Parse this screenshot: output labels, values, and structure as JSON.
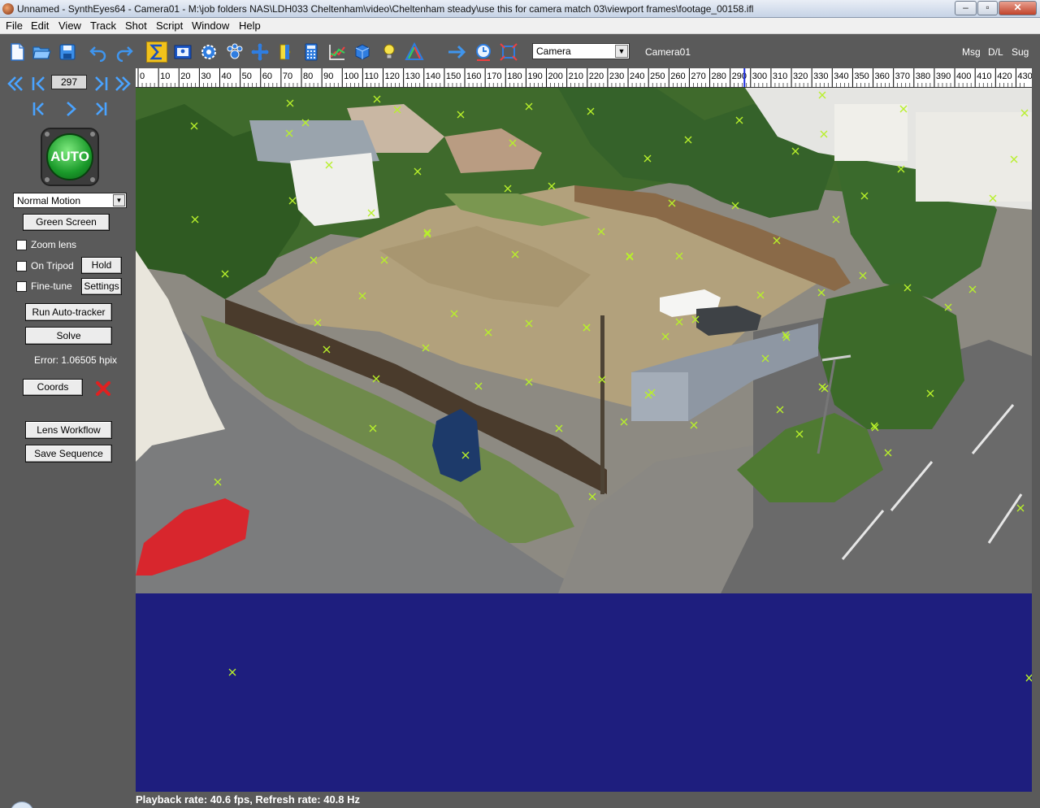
{
  "window": {
    "title": "Unnamed - SynthEyes64 - Camera01 - M:\\job folders NAS\\LDH033 Cheltenham\\video\\Cheltenham steady\\use this for camera match 03\\viewport frames\\footage_00158.ifl",
    "minimize_label": "–",
    "maximize_label": "▫",
    "close_label": "✕"
  },
  "menu": {
    "items": [
      {
        "label": "File"
      },
      {
        "label": "Edit"
      },
      {
        "label": "View"
      },
      {
        "label": "Track"
      },
      {
        "label": "Shot"
      },
      {
        "label": "Script"
      },
      {
        "label": "Window"
      },
      {
        "label": "Help"
      }
    ]
  },
  "toolbar": {
    "icons": [
      "new-file-icon",
      "open-folder-icon",
      "save-icon",
      "undo-icon",
      "redo-icon",
      "sigma-icon",
      "image-icon",
      "gear-icon",
      "paw-icon",
      "move-icon",
      "lens-icon",
      "calculator-icon",
      "graph-icon",
      "cube-icon",
      "lightbulb-icon",
      "triangle-icon",
      "arrow-right-icon",
      "clock-icon",
      "frame-icon"
    ],
    "camera_select": "Camera",
    "camera_name": "Camera01",
    "msg": "Msg",
    "dl": "D/L",
    "sug": "Sug"
  },
  "left_panel": {
    "frame_number": "297",
    "auto_label": "AUTO",
    "motion_mode": "Normal Motion",
    "green_screen": "Green Screen",
    "zoom_lens": "Zoom lens",
    "on_tripod": "On Tripod",
    "hold": "Hold",
    "fine_tune": "Fine-tune",
    "settings": "Settings",
    "run_autotracker": "Run Auto-tracker",
    "solve": "Solve",
    "error": "Error: 1.06505 hpix",
    "coords": "Coords",
    "lens_workflow": "Lens Workflow",
    "save_sequence": "Save Sequence"
  },
  "timeline": {
    "ticks": [
      "0",
      "10",
      "20",
      "30",
      "40",
      "50",
      "60",
      "70",
      "80",
      "90",
      "100",
      "110",
      "120",
      "130",
      "140",
      "150",
      "160",
      "170",
      "180",
      "190",
      "200",
      "210",
      "220",
      "230",
      "240",
      "250",
      "260",
      "270",
      "280",
      "290",
      "300",
      "310",
      "320",
      "330",
      "340",
      "350",
      "360",
      "370",
      "380",
      "390",
      "400",
      "410",
      "420",
      "430"
    ],
    "current_frame": 297,
    "total_frames": 435
  },
  "status": {
    "text": "Playback rate: 40.6 fps, Refresh rate: 40.8 Hz"
  },
  "colors": {
    "panel_bg": "#5a5a5a",
    "viewport_bg": "#1e1e7e",
    "tracker": "#b8f02a",
    "accent_active": "#f1c21c"
  }
}
